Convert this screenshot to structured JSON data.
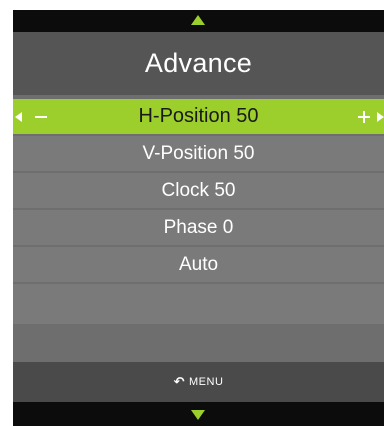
{
  "header": {
    "title": "Advance",
    "scroll_up_icon": "triangle-up-icon"
  },
  "menu": {
    "items": [
      {
        "label": "H-Position 50",
        "selected": true
      },
      {
        "label": "V-Position 50",
        "selected": false
      },
      {
        "label": "Clock 50",
        "selected": false
      },
      {
        "label": "Phase 0",
        "selected": false
      },
      {
        "label": "Auto",
        "selected": false
      },
      {
        "label": "",
        "selected": false
      }
    ],
    "decrease_icon": "minus-icon",
    "increase_icon": "plus-icon"
  },
  "footer": {
    "menu_label": "MENU",
    "back_icon": "return-arrow-icon",
    "scroll_down_icon": "triangle-down-icon"
  },
  "colors": {
    "accent": "#9ccf2b",
    "background": "#6e6e6e",
    "title_bar": "#555555",
    "item": "#7a7a7a",
    "bar": "#0c0c0c"
  }
}
